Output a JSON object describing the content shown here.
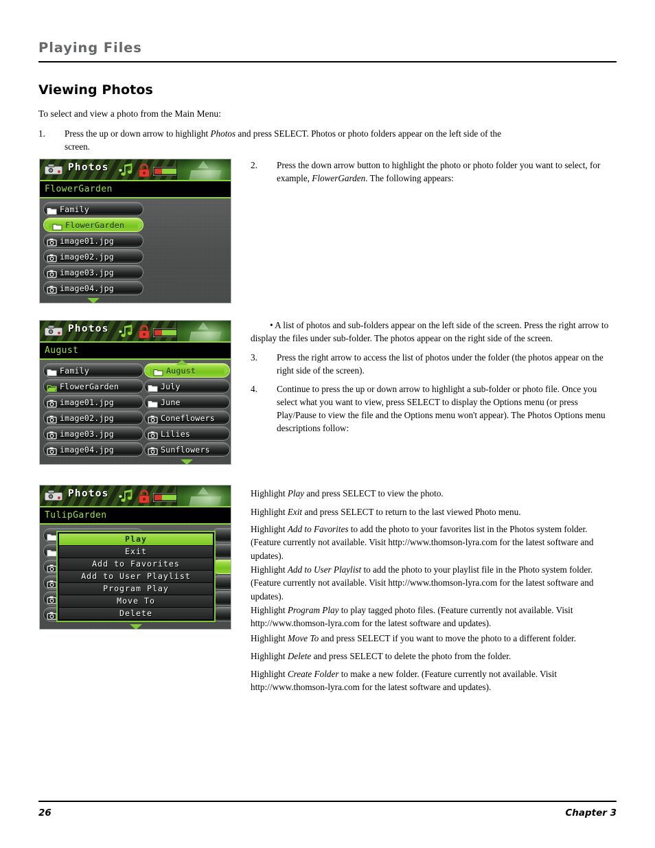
{
  "header": {
    "running_head": "Playing Files",
    "section_title": "Viewing Photos"
  },
  "intro": "To select and view a photo from the Main Menu:",
  "steps": [
    {
      "num": "1.",
      "text_before": "Press the up or down arrow to highlight ",
      "emphasis": "Photos",
      "text_after": " and press SELECT. Photos or photo folders appear on the left side of the screen."
    },
    {
      "num": "2.",
      "text_before": "Press the down arrow button to highlight the photo or photo folder you want to select, for example, ",
      "emphasis": "FlowerGarden",
      "text_after": ".  The following appears:"
    },
    {
      "num": "3.",
      "text_before": "Press the right arrow to access the list of photos under the folder (the photos appear on the right side of the screen).",
      "emphasis": "",
      "text_after": ""
    },
    {
      "num": "4.",
      "text_before": "Continue to press the up or down arrow to highlight a sub-folder or photo file. Once you select what you want to view, press SELECT to display the Options menu (or press Play/Pause to view the file and the Options menu won't appear). The Photos Options menu descriptions follow:",
      "emphasis": "",
      "text_after": ""
    }
  ],
  "bullet_note": "• A list of photos and sub-folders appear on the left side of the screen. Press the right arrow to display the files under sub-folder. The photos appear on the right side of the screen.",
  "descriptions": [
    {
      "lead": "Highlight ",
      "term": "Play",
      "rest": " and press SELECT to view the photo."
    },
    {
      "lead": "Highlight ",
      "term": "Exit",
      "rest": " and press SELECT to return to the last viewed Photo menu."
    },
    {
      "lead": "Highlight ",
      "term": "Add to Favorites",
      "rest": " to add the photo to your favorites list in the Photos system folder. (Feature currently not available. Visit http://www.thomson-lyra.com for the latest software and updates)."
    },
    {
      "lead": "Highlight ",
      "term": "Add to User Playlist",
      "rest": " to add the photo to your playlist file in the Photo system folder. (Feature currently not available. Visit http://www.thomson-lyra.com for the latest software and updates)."
    },
    {
      "lead": "Highlight ",
      "term": "Program Play",
      "rest": " to play tagged photo files. (Feature currently not available. Visit http://www.thomson-lyra.com for the latest software and updates)."
    },
    {
      "lead": "Highlight ",
      "term": "Move To",
      "rest": " and press SELECT if you want to move the photo to a different folder."
    },
    {
      "lead": "Highlight ",
      "term": "Delete",
      "rest": " and press SELECT to delete the photo from the folder."
    },
    {
      "lead": "Highlight ",
      "term": "Create Folder",
      "rest": " to make a new folder. (Feature currently not available. Visit http://www.thomson-lyra.com for the latest software and updates)."
    }
  ],
  "device_screens": [
    {
      "title": "Photos",
      "breadcrumb": "FlowerGarden",
      "status_icons": [
        "music-note-icon",
        "lock-icon",
        "battery-icon"
      ],
      "left_list": [
        {
          "label": "Family",
          "icon": "folder-icon",
          "selected": false
        },
        {
          "label": "FlowerGarden",
          "icon": "folder-icon",
          "selected": true
        },
        {
          "label": "image01.jpg",
          "icon": "camera-icon",
          "selected": false
        },
        {
          "label": "image02.jpg",
          "icon": "camera-icon",
          "selected": false
        },
        {
          "label": "image03.jpg",
          "icon": "camera-icon",
          "selected": false
        },
        {
          "label": "image04.jpg",
          "icon": "camera-icon",
          "selected": false
        }
      ],
      "right_list": [],
      "scroll_down": true,
      "scroll_up": false
    },
    {
      "title": "Photos",
      "breadcrumb": "August",
      "status_icons": [
        "music-note-icon",
        "lock-icon",
        "battery-icon"
      ],
      "left_list": [
        {
          "label": "Family",
          "icon": "folder-icon",
          "selected": false
        },
        {
          "label": "FlowerGarden",
          "icon": "folder-open-icon",
          "selected": false
        },
        {
          "label": "image01.jpg",
          "icon": "camera-icon",
          "selected": false
        },
        {
          "label": "image02.jpg",
          "icon": "camera-icon",
          "selected": false
        },
        {
          "label": "image03.jpg",
          "icon": "camera-icon",
          "selected": false
        },
        {
          "label": "image04.jpg",
          "icon": "camera-icon",
          "selected": false
        }
      ],
      "right_list": [
        {
          "label": "August",
          "icon": "folder-icon",
          "selected": true
        },
        {
          "label": "July",
          "icon": "folder-icon",
          "selected": false
        },
        {
          "label": "June",
          "icon": "folder-icon",
          "selected": false
        },
        {
          "label": "Coneflowers",
          "icon": "camera-icon",
          "selected": false
        },
        {
          "label": "Lilies",
          "icon": "camera-icon",
          "selected": false
        },
        {
          "label": "Sunflowers",
          "icon": "camera-icon",
          "selected": false
        }
      ],
      "scroll_down": true,
      "scroll_up": true
    },
    {
      "title": "Photos",
      "breadcrumb": "TulipGarden",
      "status_icons": [
        "music-note-icon",
        "lock-icon",
        "battery-icon"
      ],
      "options_menu": [
        {
          "label": "Play",
          "selected": true
        },
        {
          "label": "Exit",
          "selected": false
        },
        {
          "label": "Add to Favorites",
          "selected": false
        },
        {
          "label": "Add to User Playlist",
          "selected": false
        },
        {
          "label": "Program Play",
          "selected": false
        },
        {
          "label": "Move To",
          "selected": false
        },
        {
          "label": "Delete",
          "selected": false
        }
      ],
      "scroll_down": true
    }
  ],
  "footer": {
    "page_number": "26",
    "chapter": "Chapter 3"
  },
  "colors": {
    "accent_green": "#8dd63c",
    "selected_green": "#9ad83f",
    "running_head_gray": "#666869",
    "screen_black": "#000000"
  }
}
